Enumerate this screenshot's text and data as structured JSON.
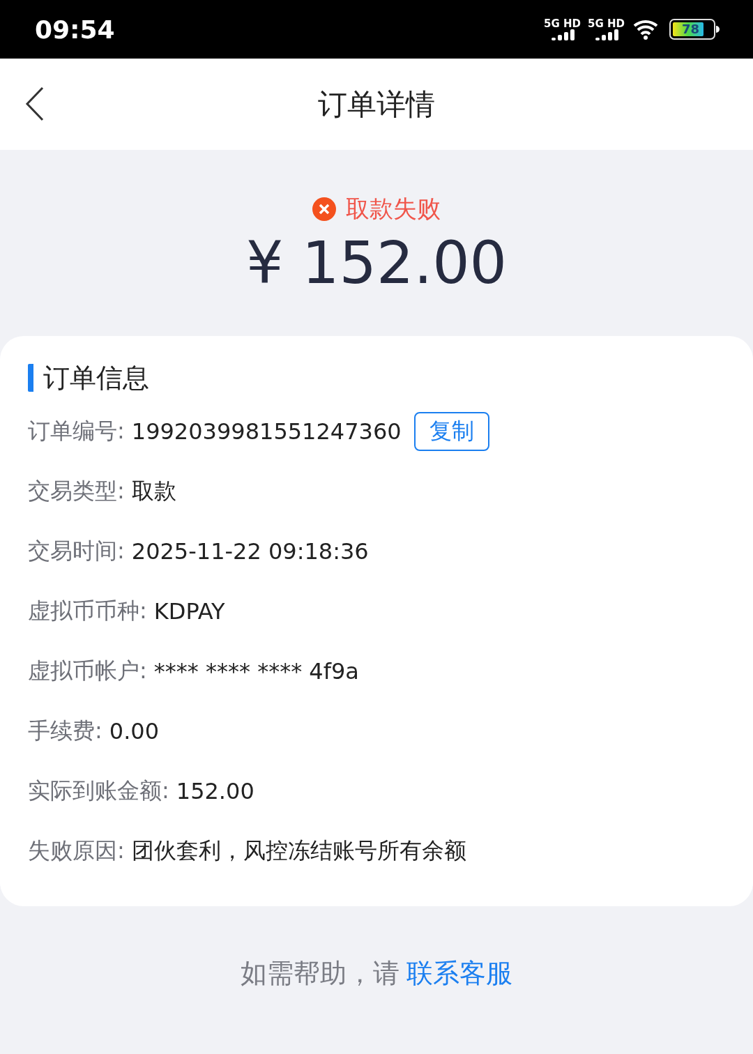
{
  "status_bar": {
    "time": "09:54",
    "networks": [
      "5G HD",
      "5G HD"
    ],
    "battery": "78"
  },
  "header": {
    "title": "订单详情"
  },
  "summary": {
    "status": "取款失败",
    "failed": true,
    "amount": "¥ 152.00"
  },
  "order_info": {
    "title": "订单信息",
    "copy_button": "复制",
    "rows": [
      {
        "label": "订单编号:",
        "value": "1992039981551247360",
        "copyable": true
      },
      {
        "label": "交易类型:",
        "value": "取款",
        "copyable": false
      },
      {
        "label": "交易时间:",
        "value": "2025-11-22 09:18:36",
        "copyable": false
      },
      {
        "label": "虚拟币币种:",
        "value": "KDPAY",
        "copyable": false
      },
      {
        "label": "虚拟币帐户:",
        "value": "**** **** **** 4f9a",
        "copyable": false
      },
      {
        "label": "手续费:",
        "value": "0.00",
        "copyable": false
      },
      {
        "label": "实际到账金额:",
        "value": "152.00",
        "copyable": false
      },
      {
        "label": "失败原因:",
        "value": "团伙套利，风控冻结账号所有余额",
        "copyable": false
      }
    ]
  },
  "footer": {
    "text": "如需帮助，请",
    "link": "联系客服"
  }
}
